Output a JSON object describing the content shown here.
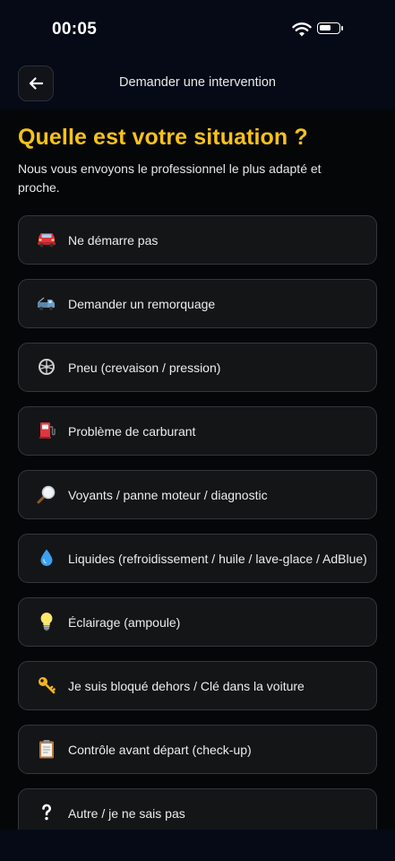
{
  "status": {
    "time": "00:05"
  },
  "nav": {
    "title": "Demander une intervention"
  },
  "page": {
    "heading": "Quelle est votre situation ?",
    "subtitle": "Nous vous envoyons le professionnel le plus adapté et proche."
  },
  "options": [
    {
      "label": "Ne démarre pas",
      "icon": "red-car-icon"
    },
    {
      "label": "Demander un remorquage",
      "icon": "tow-truck-icon"
    },
    {
      "label": "Pneu (crevaison / pression)",
      "icon": "tire-icon"
    },
    {
      "label": "Problème de carburant",
      "icon": "fuel-pump-icon"
    },
    {
      "label": "Voyants / panne moteur / diagnostic",
      "icon": "magnifier-icon"
    },
    {
      "label": "Liquides (refroidissement / huile / lave-glace / AdBlue)",
      "icon": "droplet-icon"
    },
    {
      "label": "Éclairage (ampoule)",
      "icon": "light-bulb-icon"
    },
    {
      "label": "Je suis bloqué dehors / Clé dans la voiture",
      "icon": "key-icon"
    },
    {
      "label": "Contrôle avant départ (check-up)",
      "icon": "clipboard-icon"
    },
    {
      "label": "Autre / je ne sais pas",
      "icon": "question-mark-icon"
    }
  ],
  "colors": {
    "accent": "#f7c21b",
    "background": "#050608",
    "card": "#141517"
  }
}
